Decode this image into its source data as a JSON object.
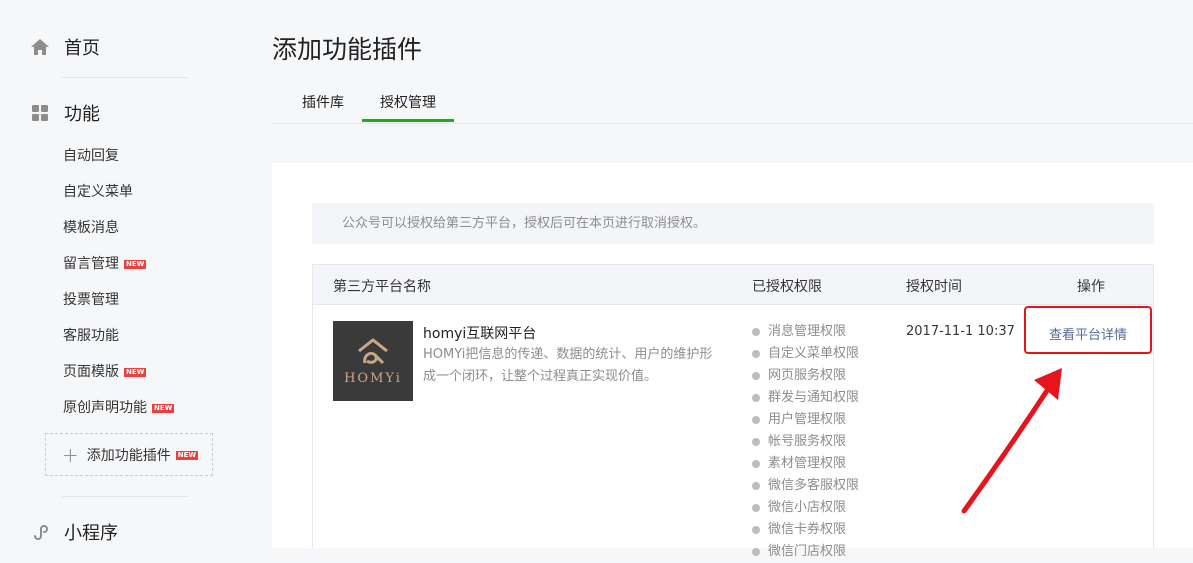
{
  "sidebar": {
    "home_label": "首页",
    "functions_label": "功能",
    "items": [
      {
        "label": "自动回复",
        "new": false
      },
      {
        "label": "自定义菜单",
        "new": false
      },
      {
        "label": "模板消息",
        "new": false
      },
      {
        "label": "留言管理",
        "new": true
      },
      {
        "label": "投票管理",
        "new": false
      },
      {
        "label": "客服功能",
        "new": false
      },
      {
        "label": "页面模版",
        "new": true
      },
      {
        "label": "原创声明功能",
        "new": true
      }
    ],
    "add_plugin_label": "添加功能插件",
    "new_badge": "NEW",
    "miniprogram_label": "小程序"
  },
  "page": {
    "title": "添加功能插件",
    "tabs": [
      {
        "label": "插件库",
        "active": false
      },
      {
        "label": "授权管理",
        "active": true
      }
    ],
    "notice": "公众号可以授权给第三方平台，授权后可在本页进行取消授权。"
  },
  "table": {
    "headers": {
      "name": "第三方平台名称",
      "permissions": "已授权权限",
      "time": "授权时间",
      "action": "操作"
    },
    "row": {
      "logo_text": "HOMYi",
      "name": "homyi互联网平台",
      "description": "HOMYi把信息的传递、数据的统计、用户的维护形成一个闭环，让整个过程真正实现价值。",
      "permissions": [
        "消息管理权限",
        "自定义菜单权限",
        "网页服务权限",
        "群发与通知权限",
        "用户管理权限",
        "帐号服务权限",
        "素材管理权限",
        "微信多客服权限",
        "微信小店权限",
        "微信卡券权限",
        "微信门店权限"
      ],
      "time": "2017-11-1 10:37",
      "action_label": "查看平台详情"
    }
  },
  "colors": {
    "accent_green": "#1aad19",
    "link_blue": "#576b95",
    "annotation_red": "#e8141b",
    "new_badge_red": "#e64340"
  }
}
